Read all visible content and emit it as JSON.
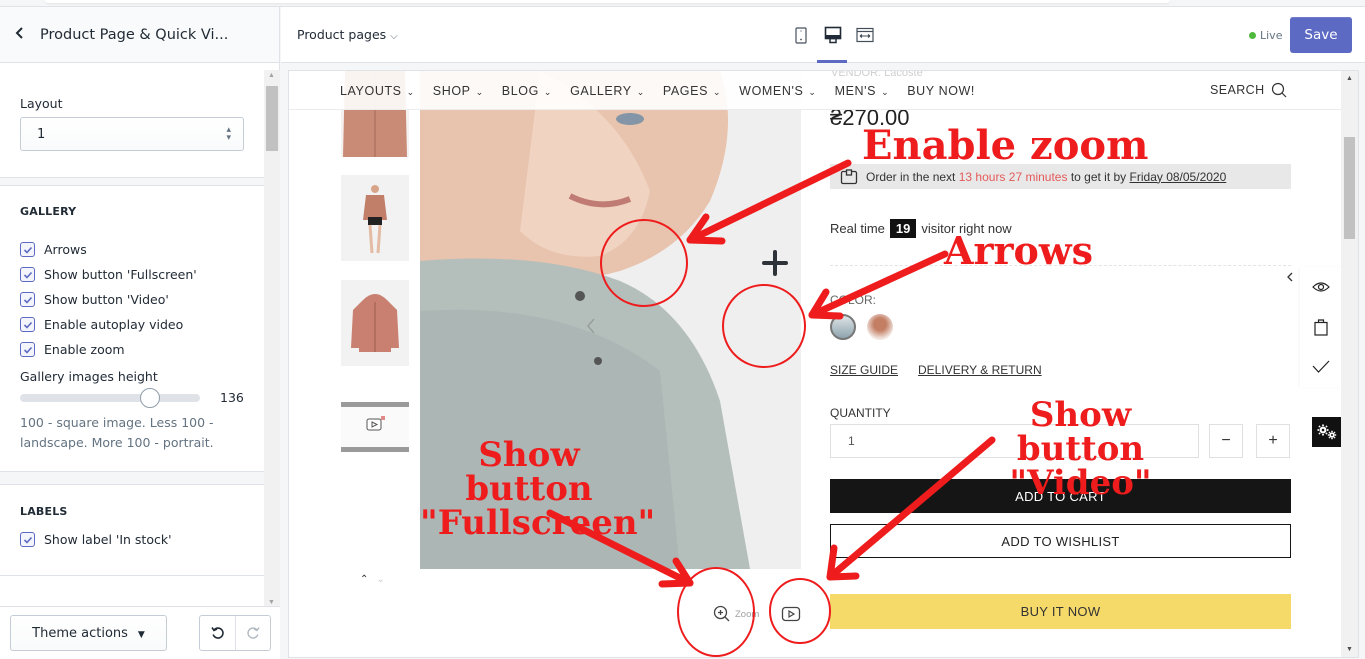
{
  "sidebar": {
    "back_label": "<",
    "title": "Product Page & Quick Vi...",
    "layout": {
      "label": "Layout",
      "value": "1"
    },
    "gallery": {
      "title": "GALLERY",
      "options": [
        {
          "label": "Arrows",
          "checked": true
        },
        {
          "label": "Show button 'Fullscreen'",
          "checked": true
        },
        {
          "label": "Show button 'Video'",
          "checked": true
        },
        {
          "label": "Enable autoplay video",
          "checked": true
        },
        {
          "label": "Enable zoom",
          "checked": true
        }
      ],
      "height_label": "Gallery images height",
      "height_value": "136",
      "height_fraction": 0.72,
      "help": "100 - square image. Less 100 - landscape. More 100 - portrait."
    },
    "labels": {
      "title": "LABELS",
      "options": [
        {
          "label": "Show label 'In stock'",
          "checked": true
        }
      ]
    },
    "footer": {
      "theme_actions": "Theme actions"
    }
  },
  "topbar": {
    "page_select": "Product pages",
    "devices": [
      "mobile",
      "desktop",
      "fullwidth"
    ],
    "active_device": "desktop",
    "status": "Live",
    "save_label": "Save",
    "colors": {
      "accent": "#5c6ac4",
      "live": "#50b83c"
    }
  },
  "preview": {
    "nav": {
      "items": [
        "LAYOUTS",
        "SHOP",
        "BLOG",
        "GALLERY",
        "PAGES",
        "WOMEN'S",
        "MEN'S",
        "BUY NOW!"
      ],
      "dropdown_flags": [
        true,
        true,
        true,
        true,
        true,
        true,
        true,
        false
      ],
      "search": "SEARCH"
    },
    "product": {
      "vendor": "VENDOR: Lacoste",
      "price": "₴270.00",
      "order": {
        "prefix": "Order in the next",
        "time": "13 hours 27 minutes",
        "middle": "to get it by",
        "date": "Friday 08/05/2020"
      },
      "visitors": {
        "prefix": "Real time",
        "count": "19",
        "suffix": "visitor right now"
      },
      "color_label": "COLOR:",
      "links": [
        "SIZE GUIDE",
        "DELIVERY & RETURN"
      ],
      "quantity_label": "QUANTITY",
      "quantity_value": "1",
      "minus": "−",
      "plus": "+",
      "add_to_cart": "ADD TO CART",
      "add_to_wishlist": "ADD TO WISHLIST",
      "buy_now": "BUY IT NOW"
    },
    "gallery": {
      "zoom_label": "Zoom"
    }
  },
  "annotations": [
    {
      "id": "enable-zoom",
      "text": "Enable zoom"
    },
    {
      "id": "arrows",
      "text": "Arrows"
    },
    {
      "id": "show-video",
      "line1": "Show button",
      "line2": "\"Video\""
    },
    {
      "id": "show-fullscreen",
      "line1": "Show button",
      "line2": "\"Fullscreen\""
    }
  ]
}
